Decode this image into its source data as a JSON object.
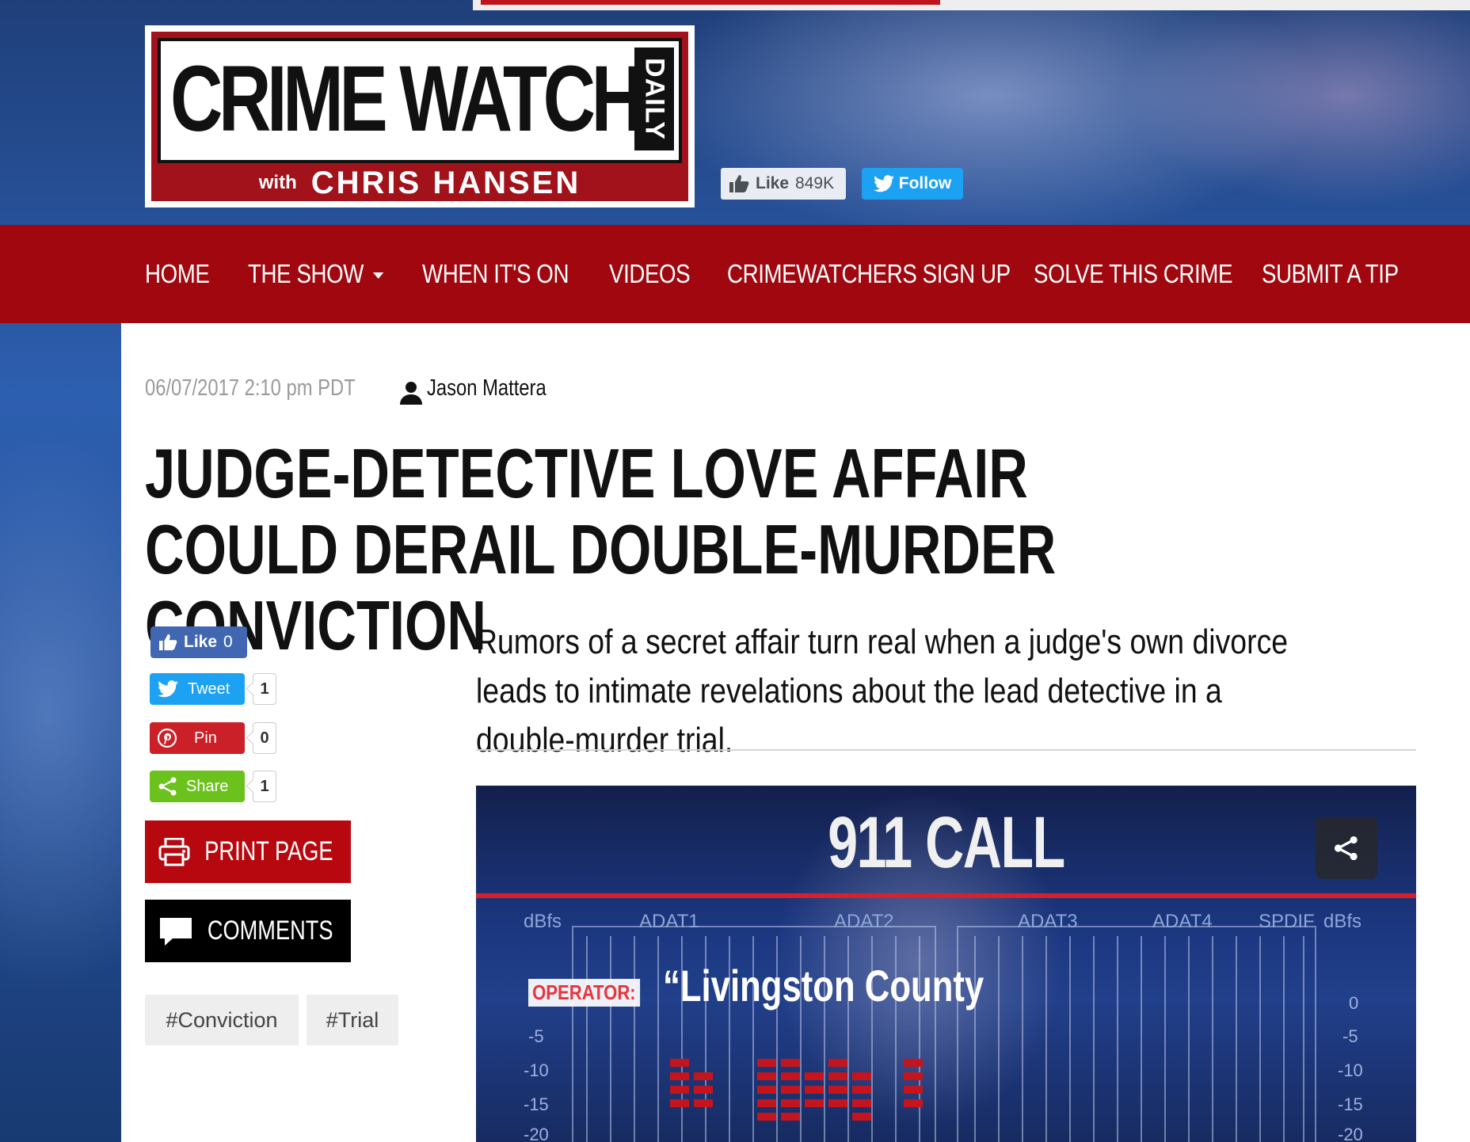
{
  "logo": {
    "main": "CRIME WATCH",
    "daily": "DAILY",
    "with": "with",
    "host": "CHRIS HANSEN"
  },
  "social_header": {
    "fb_like_label": "Like",
    "fb_like_count": "849K",
    "twitter_follow_label": "Follow"
  },
  "nav": {
    "items": [
      "HOME",
      "THE SHOW",
      "WHEN IT'S ON",
      "VIDEOS",
      "CRIMEWATCHERS SIGN UP",
      "SOLVE THIS CRIME",
      "SUBMIT A TIP"
    ]
  },
  "article": {
    "date": "06/07/2017 2:10 pm PDT",
    "author": "Jason Mattera",
    "title": "JUDGE-DETECTIVE LOVE AFFAIR COULD DERAIL DOUBLE-MURDER CONVICTION",
    "lede": "Rumors of a secret affair turn real when a judge's own divorce leads to intimate revelations about the lead detective in a double-murder trial."
  },
  "share": {
    "fb_label": "Like",
    "fb_count": "0",
    "tweet_label": "Tweet",
    "tweet_count": "1",
    "pin_label": "Pin",
    "pin_count": "0",
    "share_label": "Share",
    "share_count": "1"
  },
  "buttons": {
    "print": "PRINT PAGE",
    "comments": "COMMENTS"
  },
  "tags": [
    "#Conviction",
    "#Trial"
  ],
  "video": {
    "title": "911 CALL",
    "labels": [
      "dBfs",
      "ADAT1",
      "ADAT2",
      "ADAT3",
      "ADAT4",
      "SPDIF",
      "dBfs"
    ],
    "operator": "OPERATOR:",
    "quote": "“Livingston County",
    "db_left": [
      "-5",
      "-10",
      "-15",
      "-20"
    ],
    "db_right": [
      "0",
      "-5",
      "-10",
      "-15",
      "-20"
    ]
  },
  "colors": {
    "nav_red": "#a0070f",
    "print_red": "#b7080f",
    "facebook": "#4267b2",
    "twitter": "#1da1f2",
    "pinterest": "#cb2027",
    "share_green": "#6cc21d"
  }
}
